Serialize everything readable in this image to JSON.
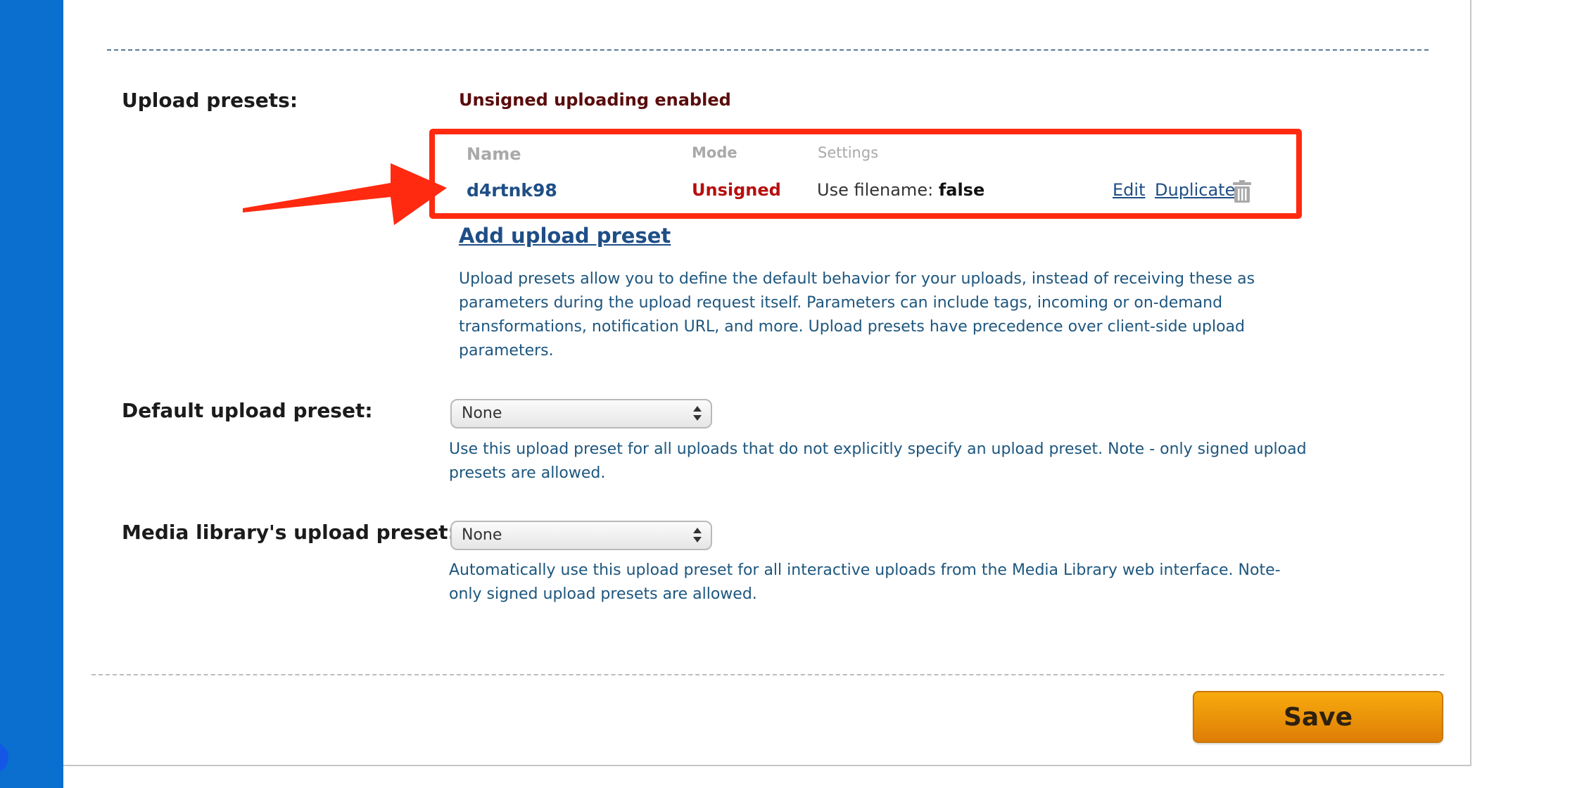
{
  "sections": {
    "upload_presets": {
      "label": "Upload presets:",
      "status": "Unsigned uploading enabled",
      "table": {
        "headers": {
          "name": "Name",
          "mode": "Mode",
          "settings": "Settings"
        },
        "rows": [
          {
            "name": "d4rtnk98",
            "mode": "Unsigned",
            "settings_label": "Use filename:",
            "settings_value": "false",
            "edit": "Edit",
            "duplicate": "Duplicate"
          }
        ]
      },
      "add_link": "Add upload preset",
      "description": "Upload presets allow you to define the default behavior for your uploads, instead of receiving these as parameters during the upload request itself. Parameters can include tags, incoming or on-demand transformations, notification URL, and more. Upload presets have precedence over client-side upload parameters."
    },
    "default_preset": {
      "label": "Default upload preset:",
      "selected": "None",
      "description": "Use this upload preset for all uploads that do not explicitly specify an upload preset. Note - only signed upload presets are allowed."
    },
    "media_library_preset": {
      "label": "Media library's upload preset:",
      "selected": "None",
      "description": "Automatically use this upload preset for all interactive uploads from the Media Library web interface. Note- only signed upload presets are allowed."
    }
  },
  "actions": {
    "save": "Save"
  },
  "icons": {
    "delete": "trash-icon",
    "annotation": "red-arrow-annotation"
  },
  "colors": {
    "sidebar": "#0a6fce",
    "link": "#1e4e86",
    "mode_unsigned": "#b80e0e",
    "highlight_box": "#ff2a10",
    "save_button": "#f29d0b"
  }
}
